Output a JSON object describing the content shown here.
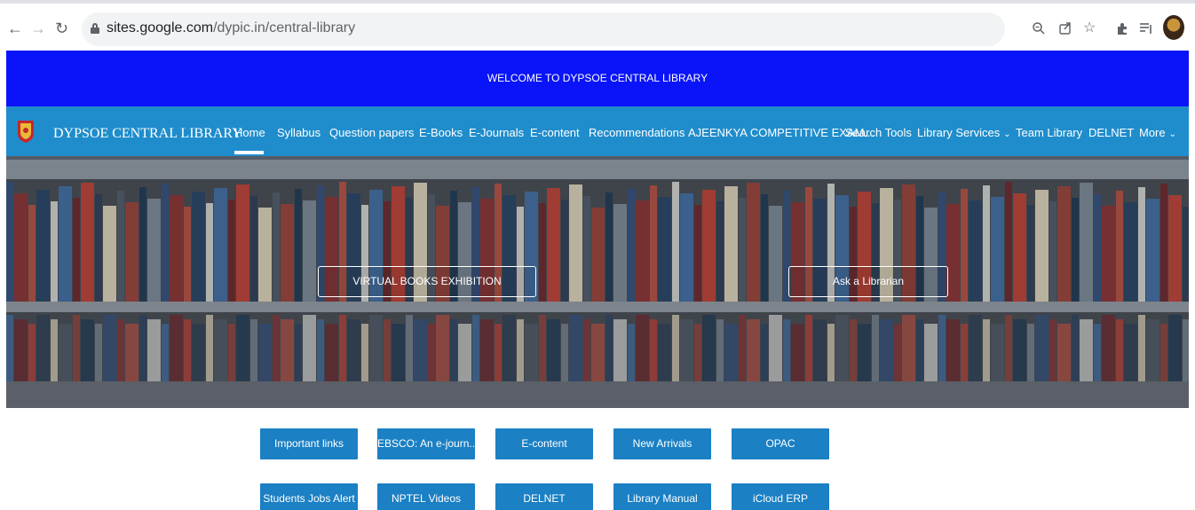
{
  "browser": {
    "url_domain": "sites.google.com",
    "url_path": "/dypic.in/central-library",
    "icons": [
      "back-arrow-icon",
      "forward-arrow-icon",
      "reload-icon",
      "lock-icon",
      "zoom-icon",
      "share-icon",
      "star-icon",
      "extensions-icon",
      "reading-list-icon",
      "profile-avatar"
    ]
  },
  "announcement": {
    "text": "WELCOME TO DYPSOE CENTRAL LIBRARY",
    "background": "#0a14f8"
  },
  "header": {
    "site_title": "DYPSOE CENTRAL LIBRARY",
    "background": "#1f8dcc",
    "nav": [
      {
        "label": "Home",
        "active": true
      },
      {
        "label": "Syllabus"
      },
      {
        "label": "Question papers"
      },
      {
        "label": "E-Books"
      },
      {
        "label": "E-Journals"
      },
      {
        "label": "E-content"
      },
      {
        "label": "Recommendations"
      },
      {
        "label": "AJEENKYA COMPETITIVE EXAM..."
      },
      {
        "label": "Search Tools"
      },
      {
        "label": "Library Services",
        "dropdown": true
      },
      {
        "label": "Team Library"
      },
      {
        "label": "DELNET"
      },
      {
        "label": "More",
        "dropdown": true
      }
    ]
  },
  "hero": {
    "buttons": [
      {
        "label": "VIRTUAL BOOKS EXHIBITION"
      },
      {
        "label": "Ask a Librarian"
      }
    ]
  },
  "quick_links": {
    "button_color": "#1b80c4",
    "rows": [
      [
        "Important links",
        "EBSCO: An e-journ...",
        "E-content",
        "New Arrivals",
        "OPAC"
      ],
      [
        "Students Jobs Alert",
        "NPTEL Videos",
        "DELNET",
        "Library Manual",
        "iCloud ERP"
      ]
    ]
  }
}
